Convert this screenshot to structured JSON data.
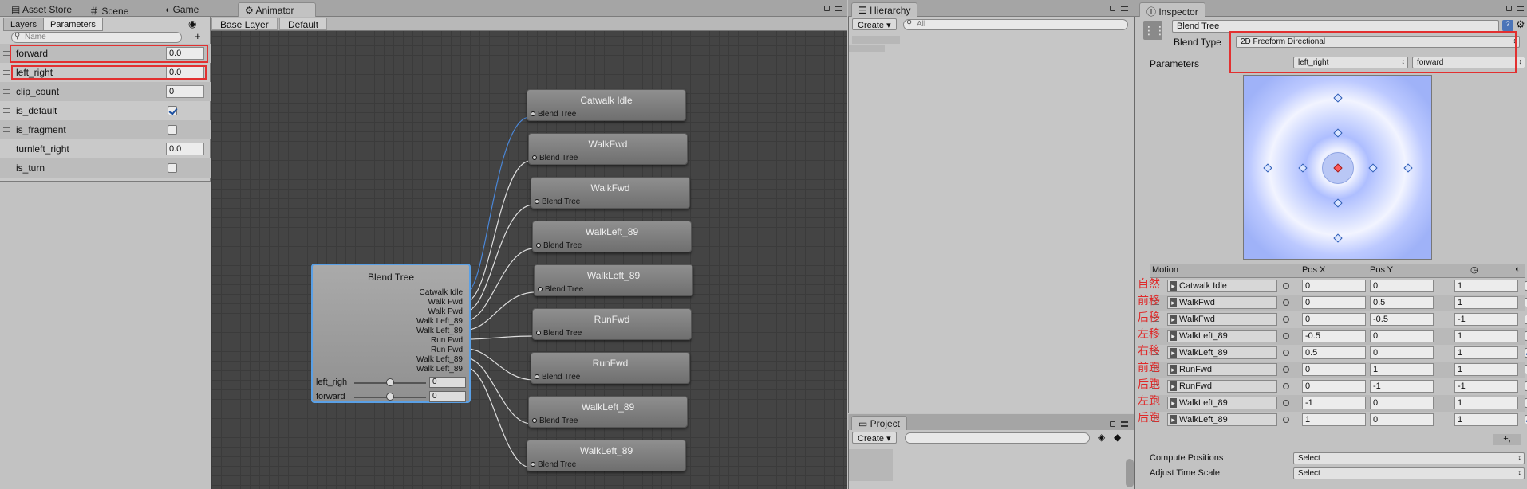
{
  "top_tabs_left": [
    {
      "label": "Asset Store",
      "icon": "store-icon"
    },
    {
      "label": "Scene",
      "icon": "scene-icon"
    },
    {
      "label": "Game",
      "icon": "game-icon"
    },
    {
      "label": "Animator",
      "icon": "animator-icon"
    }
  ],
  "params_panel": {
    "tabs": [
      "Layers",
      "Parameters"
    ],
    "search_placeholder": "Name",
    "add_label": "+",
    "params": [
      {
        "name": "forward",
        "value": "0.0",
        "kind": "float"
      },
      {
        "name": "left_right",
        "value": "0.0",
        "kind": "float"
      },
      {
        "name": "clip_count",
        "value": "0",
        "kind": "int"
      },
      {
        "name": "is_default",
        "value": true,
        "kind": "bool"
      },
      {
        "name": "is_fragment",
        "value": false,
        "kind": "bool"
      },
      {
        "name": "turnleft_right",
        "value": "0.0",
        "kind": "float"
      },
      {
        "name": "is_turn",
        "value": false,
        "kind": "bool"
      }
    ]
  },
  "breadcrumb": [
    "Base Layer",
    "Default"
  ],
  "blend_tree_node": {
    "title": "Blend Tree",
    "outputs": [
      "Catwalk Idle",
      "Walk Fwd",
      "Walk Fwd",
      "Walk Left_89",
      "Walk Left_89",
      "Run Fwd",
      "Run Fwd",
      "Walk Left_89",
      "Walk Left_89"
    ],
    "sliders": [
      {
        "label": "left_righ",
        "value": "0",
        "level": 0.5
      },
      {
        "label": "forward",
        "value": "0",
        "level": 0.5
      }
    ]
  },
  "motion_nodes": [
    {
      "title": "Catwalk Idle",
      "port": "Blend Tree"
    },
    {
      "title": "WalkFwd",
      "port": "Blend Tree"
    },
    {
      "title": "WalkFwd",
      "port": "Blend Tree"
    },
    {
      "title": "WalkLeft_89",
      "port": "Blend Tree"
    },
    {
      "title": "WalkLeft_89",
      "port": "Blend Tree"
    },
    {
      "title": "RunFwd",
      "port": "Blend Tree"
    },
    {
      "title": "RunFwd",
      "port": "Blend Tree"
    },
    {
      "title": "WalkLeft_89",
      "port": "Blend Tree"
    },
    {
      "title": "WalkLeft_89",
      "port": "Blend Tree"
    }
  ],
  "hierarchy": {
    "tab": "Hierarchy",
    "create_label": "Create",
    "search_placeholder": "All"
  },
  "project": {
    "tab": "Project",
    "create_label": "Create"
  },
  "inspector": {
    "tab": "Inspector",
    "object_name": "Blend Tree",
    "blend_type_label": "Blend Type",
    "blend_type_value": "2D Freeform Directional",
    "parameters_label": "Parameters",
    "param_x": "left_right",
    "param_y": "forward",
    "columns": {
      "motion": "Motion",
      "posx": "Pos X",
      "posy": "Pos Y"
    },
    "motions": [
      {
        "name": "Catwalk Idle",
        "x": "0",
        "y": "0",
        "speed": "1",
        "mirror": false,
        "note": "自然"
      },
      {
        "name": "WalkFwd",
        "x": "0",
        "y": "0.5",
        "speed": "1",
        "mirror": false,
        "note": "前移"
      },
      {
        "name": "WalkFwd",
        "x": "0",
        "y": "-0.5",
        "speed": "-1",
        "mirror": false,
        "note": "后移"
      },
      {
        "name": "WalkLeft_89",
        "x": "-0.5",
        "y": "0",
        "speed": "1",
        "mirror": false,
        "note": "左移"
      },
      {
        "name": "WalkLeft_89",
        "x": "0.5",
        "y": "0",
        "speed": "1",
        "mirror": true,
        "note": "右移"
      },
      {
        "name": "RunFwd",
        "x": "0",
        "y": "1",
        "speed": "1",
        "mirror": false,
        "note": "前跑"
      },
      {
        "name": "RunFwd",
        "x": "0",
        "y": "-1",
        "speed": "-1",
        "mirror": false,
        "note": "后跑"
      },
      {
        "name": "WalkLeft_89",
        "x": "-1",
        "y": "0",
        "speed": "1",
        "mirror": false,
        "note": "左跑"
      },
      {
        "name": "WalkLeft_89",
        "x": "1",
        "y": "0",
        "speed": "1",
        "mirror": true,
        "note": "后跑"
      }
    ],
    "add_minus": "+,",
    "compute_positions_label": "Compute Positions",
    "compute_positions_value": "Select",
    "adjust_time_label": "Adjust Time Scale",
    "adjust_time_value": "Select"
  },
  "colors": {
    "highlight": "#e23030",
    "selection": "#5aa0e6",
    "annotation": "#e02828"
  }
}
